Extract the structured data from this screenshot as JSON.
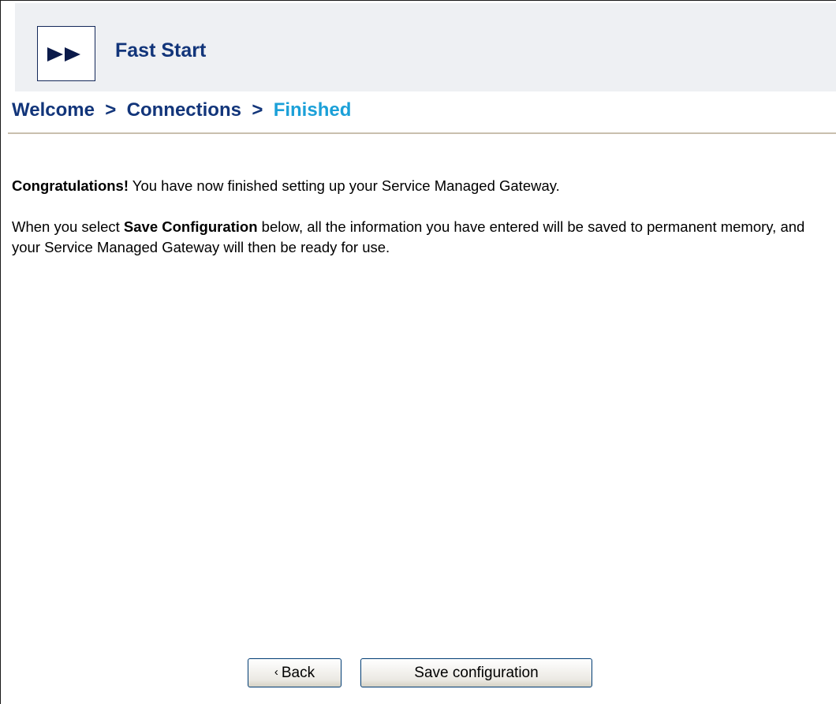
{
  "header": {
    "title": "Fast Start",
    "logo_icon": "fast-forward-icon"
  },
  "breadcrumb": {
    "items": [
      "Welcome",
      "Connections",
      "Finished"
    ],
    "separator": ">",
    "current_color": "#1ba0d8",
    "past_color": "#12357a"
  },
  "content": {
    "congrats_strong": "Congratulations!",
    "congrats_rest": " You have now finished setting up your Service Managed Gateway.",
    "info_pre": "When you select ",
    "info_strong": "Save Configuration",
    "info_post": " below, all the information you have entered will be saved to permanent memory, and your Service Managed Gateway will then be ready for use."
  },
  "buttons": {
    "back_label": "Back",
    "back_icon": "chevron-left-icon",
    "save_label": "Save configuration"
  }
}
